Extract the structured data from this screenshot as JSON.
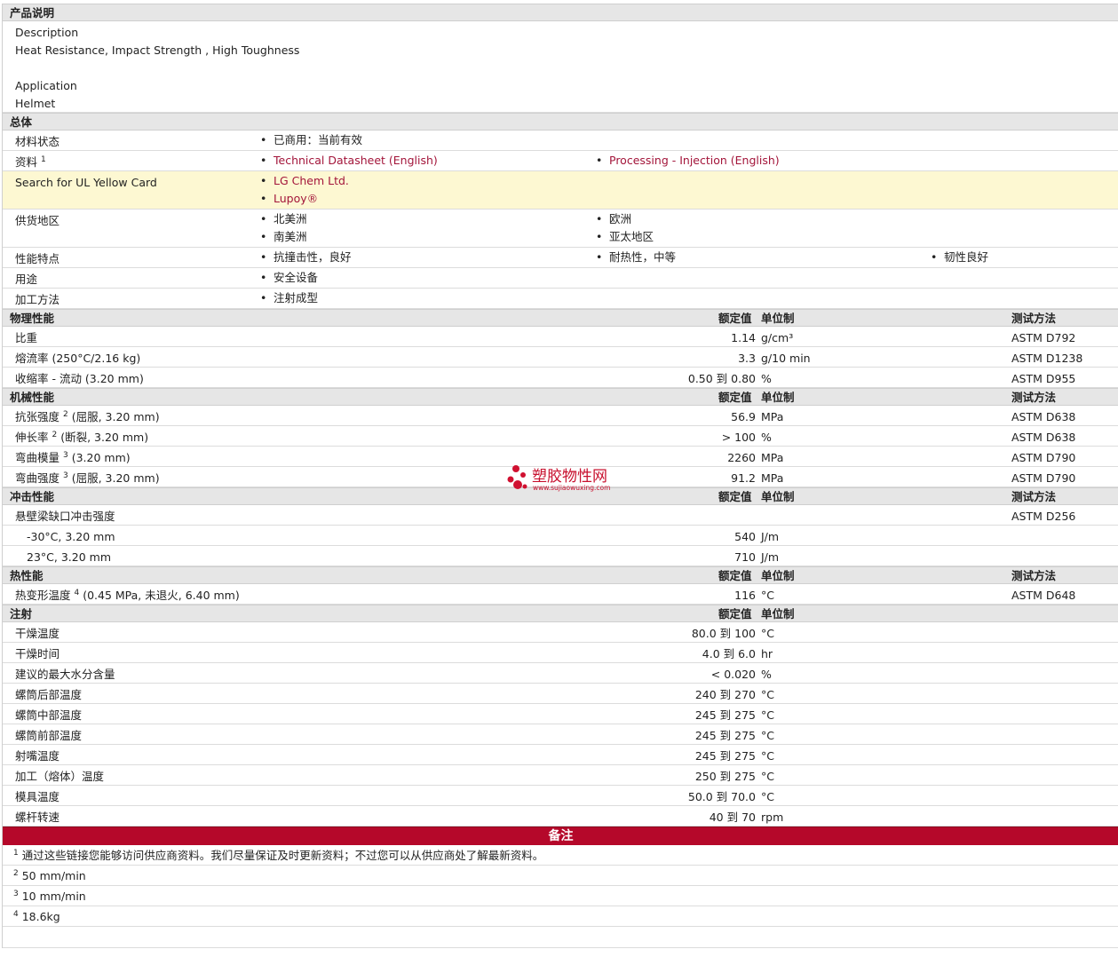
{
  "product": {
    "title": "产品说明",
    "desc_label": "Description",
    "desc_text": "Heat Resistance, Impact Strength , High Toughness",
    "app_label": "Application",
    "app_text": "Helmet"
  },
  "general": {
    "title": "总体",
    "status_label": "材料状态",
    "status_value": "已商用：当前有效",
    "docs_label": "资料",
    "docs_sup": "1",
    "doc1": "Technical Datasheet (English)",
    "doc2": "Processing - Injection (English)",
    "ul_label": "Search for UL Yellow Card",
    "ul1": "LG Chem Ltd.",
    "ul2": "Lupoy®",
    "region_label": "供货地区",
    "regions": [
      "北美洲",
      "欧洲",
      "南美洲",
      "亚太地区"
    ],
    "feature_label": "性能特点",
    "features": [
      "抗撞击性，良好",
      "耐热性，中等",
      "韧性良好"
    ],
    "use_label": "用途",
    "use_value": "安全设备",
    "method_label": "加工方法",
    "method_value": "注射成型"
  },
  "headers": {
    "value": "额定值",
    "unit": "单位制",
    "test": "测试方法"
  },
  "physical": {
    "title": "物理性能",
    "rows": [
      {
        "label": "比重",
        "value": "1.14",
        "unit": "g/cm³",
        "test": "ASTM D792"
      },
      {
        "label": "熔流率  (250°C/2.16 kg)",
        "value": "3.3",
        "unit": "g/10 min",
        "test": "ASTM D1238"
      },
      {
        "label": "收缩率  - 流动  (3.20 mm)",
        "value": "0.50 到  0.80",
        "unit": "%",
        "test": "ASTM D955"
      }
    ]
  },
  "mechanical": {
    "title": "机械性能",
    "rows": [
      {
        "label": "抗张强度",
        "sup": "2",
        "cond": " (屈服, 3.20 mm)",
        "value": "56.9",
        "unit": "MPa",
        "test": "ASTM D638"
      },
      {
        "label": "伸长率",
        "sup": "2",
        "cond": " (断裂, 3.20 mm)",
        "value": "> 100",
        "unit": "%",
        "test": "ASTM D638"
      },
      {
        "label": "弯曲模量",
        "sup": "3",
        "cond": " (3.20 mm)",
        "value": "2260",
        "unit": "MPa",
        "test": "ASTM D790"
      },
      {
        "label": "弯曲强度",
        "sup": "3",
        "cond": " (屈服, 3.20 mm)",
        "value": "91.2",
        "unit": "MPa",
        "test": "ASTM D790"
      }
    ]
  },
  "impact": {
    "title": "冲击性能",
    "main_label": "悬壁梁缺口冲击强度",
    "main_test": "ASTM D256",
    "rows": [
      {
        "label": "-30°C, 3.20 mm",
        "value": "540",
        "unit": "J/m"
      },
      {
        "label": "23°C, 3.20 mm",
        "value": "710",
        "unit": "J/m"
      }
    ]
  },
  "thermal": {
    "title": "热性能",
    "label": "热变形温度",
    "sup": "4",
    "cond": " (0.45 MPa, 未退火, 6.40 mm)",
    "value": "116",
    "unit": "°C",
    "test": "ASTM D648"
  },
  "injection": {
    "title": "注射",
    "rows": [
      {
        "label": "干燥温度",
        "value": "80.0 到  100",
        "unit": "°C"
      },
      {
        "label": "干燥时间",
        "value": "4.0 到  6.0",
        "unit": "hr"
      },
      {
        "label": "建议的最大水分含量",
        "value": "< 0.020",
        "unit": "%"
      },
      {
        "label": "螺筒后部温度",
        "value": "240 到  270",
        "unit": "°C"
      },
      {
        "label": "螺筒中部温度",
        "value": "245 到  275",
        "unit": "°C"
      },
      {
        "label": "螺筒前部温度",
        "value": "245 到  275",
        "unit": "°C"
      },
      {
        "label": "射嘴温度",
        "value": "245 到  275",
        "unit": "°C"
      },
      {
        "label": "加工（熔体）温度",
        "value": "250 到  275",
        "unit": "°C"
      },
      {
        "label": "模具温度",
        "value": "50.0 到  70.0",
        "unit": "°C"
      },
      {
        "label": "螺杆转速",
        "value": "40 到  70",
        "unit": "rpm"
      }
    ]
  },
  "notes": {
    "title": "备注",
    "items": [
      {
        "sup": "1",
        "text": "通过这些链接您能够访问供应商资料。我们尽量保证及时更新资料；不过您可以从供应商处了解最新资料。"
      },
      {
        "sup": "2",
        "text": "50 mm/min"
      },
      {
        "sup": "3",
        "text": "10 mm/min"
      },
      {
        "sup": "4",
        "text": "18.6kg"
      }
    ]
  },
  "watermark": {
    "name": "塑胶物性网",
    "url": "www.sujiaowuxing.com"
  }
}
